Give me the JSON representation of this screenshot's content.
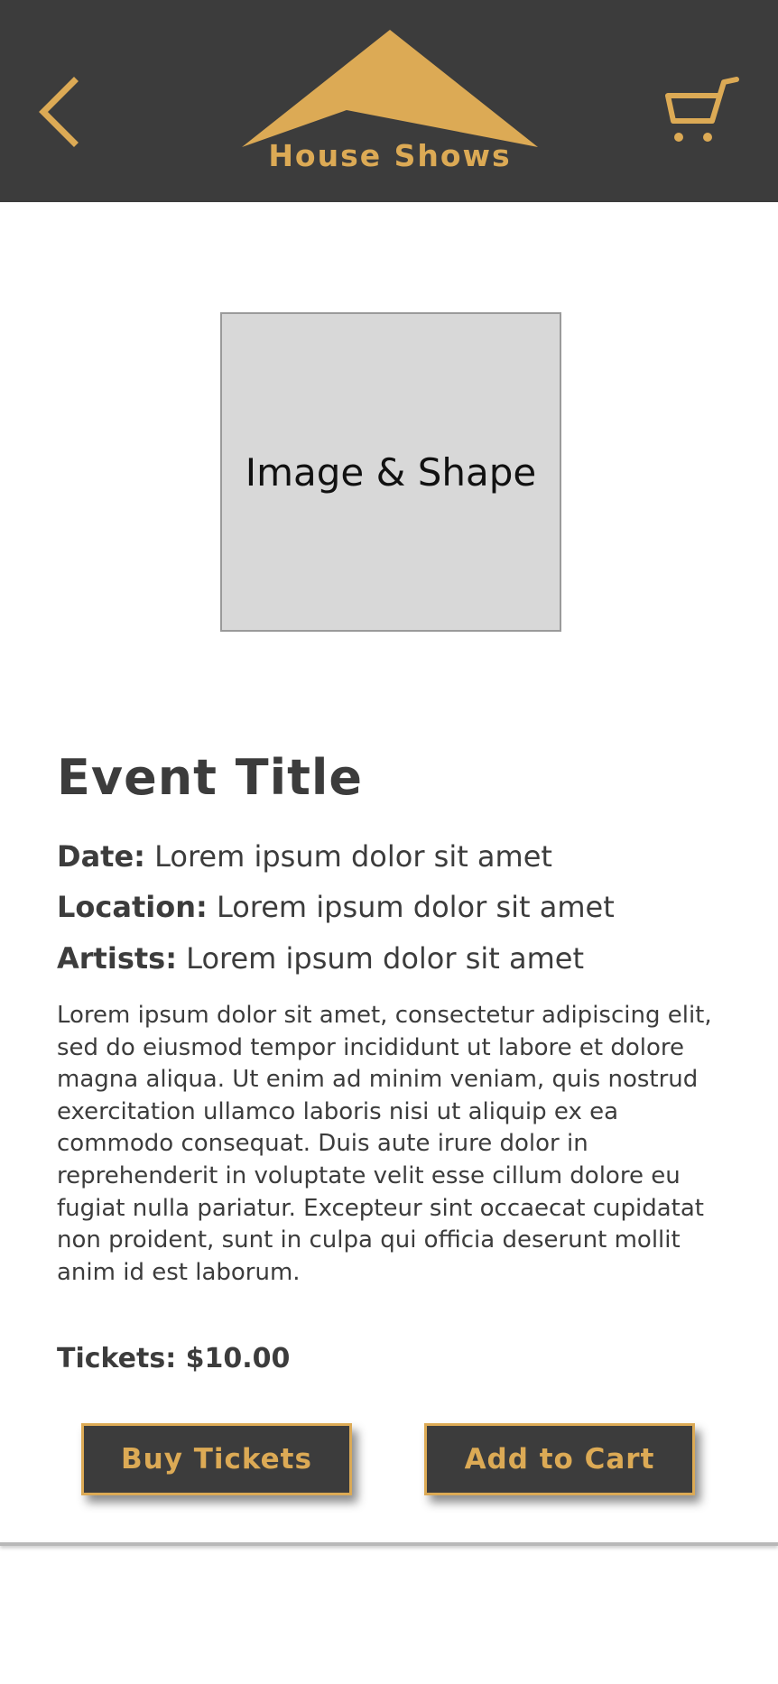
{
  "header": {
    "brand_name": "House Shows",
    "back_icon": "chevron-left-icon",
    "cart_icon": "shopping-cart-icon",
    "background_color": "#3c3c3c",
    "accent_color": "#dcaa55"
  },
  "hero": {
    "image_placeholder_label": "Image & Shape"
  },
  "event": {
    "title": "Event Title",
    "date_label": "Date:",
    "date_value": "Lorem ipsum dolor sit amet",
    "location_label": "Location:",
    "location_value": "Lorem ipsum dolor sit amet",
    "artists_label": "Artists:",
    "artists_value": "Lorem ipsum dolor sit amet",
    "description": "Lorem ipsum dolor sit amet, consectetur adipiscing elit, sed do eiusmod tempor incididunt ut labore et dolore magna aliqua. Ut enim ad minim veniam, quis nostrud exercitation ullamco laboris nisi ut aliquip ex ea commodo consequat. Duis aute irure dolor in reprehenderit in voluptate velit esse cillum dolore eu fugiat nulla pariatur. Excepteur sint occaecat cupidatat non proident, sunt in culpa qui officia deserunt mollit anim id est laborum.",
    "tickets_text": "Tickets: $10.00"
  },
  "actions": {
    "buy_label": "Buy Tickets",
    "cart_label": "Add to Cart"
  }
}
